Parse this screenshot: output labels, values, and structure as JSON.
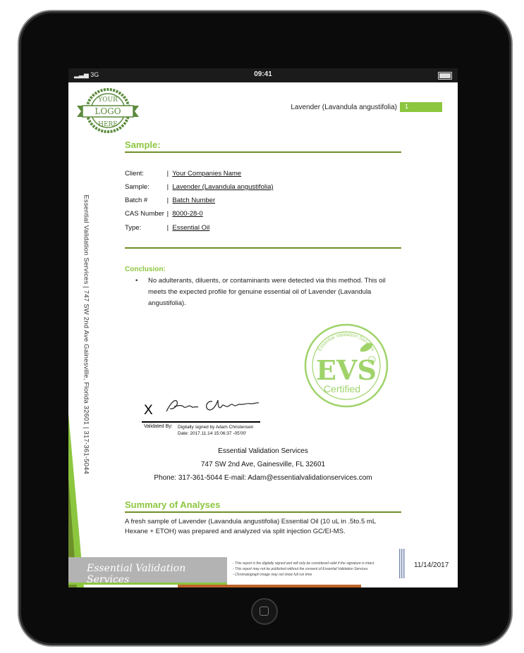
{
  "status_bar": {
    "carrier": "3G",
    "time": "09:41"
  },
  "logo": {
    "line1": "YOUR",
    "line2": "LOGO",
    "line3": "HERE"
  },
  "header": {
    "product": "Lavender (Lavandula angustifolia)",
    "page_number": "1"
  },
  "sample": {
    "heading": "Sample:",
    "fields": [
      {
        "label": "Client:",
        "sep": "|",
        "value": "Your Companies Name"
      },
      {
        "label": "Sample:",
        "sep": "|",
        "value": "Lavender (Lavandula angustifolia)"
      },
      {
        "label": "Batch #",
        "sep": "|",
        "value": "Batch Number"
      },
      {
        "label": "CAS Number",
        "sep": "|",
        "value": "8000-28-0"
      },
      {
        "label": "Type:",
        "sep": "|",
        "value": "Essential Oil"
      }
    ]
  },
  "conclusion": {
    "heading": "Conclusion:",
    "bullet": "No adulterants, diluents, or contaminants were detected via this method. This oil meets the expected profile for genuine essential oil of Lavender (Lavandula angustifolia)."
  },
  "seal": {
    "ring_text": "Essential Validation Services",
    "letters": "EVS",
    "tm": "TM",
    "label": "Certified"
  },
  "signature": {
    "x_mark": "X",
    "validated_by": "Validated By:",
    "digital_line1": "Digitally signed by Adam Christensen",
    "digital_line2": "Date: 2017.11.14 15:06:37 -05'00'"
  },
  "company": {
    "name": "Essential Validation Services",
    "address": "747 SW 2nd Ave, Gainesville, FL 32601",
    "contact": "Phone:  317-361-5044     E-mail:  Adam@essentialvalidationservices.com"
  },
  "summary": {
    "heading": "Summary of Analyses",
    "text": "A fresh sample of Lavender (Lavandula angustifolia) Essential Oil (10 uL in .5to.5 mL Hexane + ETOH) was prepared and analyzed via split injection GC/EI-MS."
  },
  "side_text": "Essential Validation Services | 747 SW 2nd Ave Gainesville, Florida 32601 | 317-361-5044",
  "footer": {
    "banner": "Essential Validation Services",
    "notes": [
      "- This report is the digitally signed and will only be considered valid if the signature is intact.",
      "- This report may not be published without the consent of Essential Validation Services.",
      "- Chromatograph image may not show full run time"
    ],
    "date": "11/14/2017"
  },
  "colors": {
    "accent_green": "#8cc63f",
    "rule_green": "#6e8f2a",
    "logo_green": "#5b8a3c",
    "seal_green": "#9fd36a"
  }
}
